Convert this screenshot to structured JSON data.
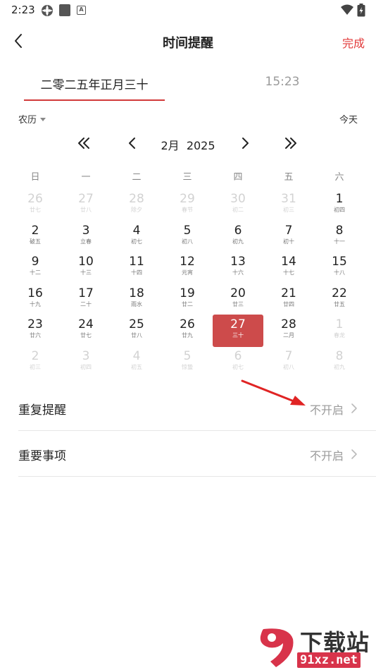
{
  "status_bar": {
    "time": "2:23"
  },
  "header": {
    "title": "时间提醒",
    "done_label": "完成"
  },
  "tabs": {
    "date_label": "二零二五年正月三十",
    "time_label": "15:23"
  },
  "toolbar": {
    "calendar_type": "农历",
    "today_label": "今天"
  },
  "month_nav": {
    "month": "2月",
    "year": "2025"
  },
  "weekdays": [
    "日",
    "一",
    "二",
    "三",
    "四",
    "五",
    "六"
  ],
  "calendar": {
    "selected_day": "27",
    "weeks": [
      [
        {
          "d": "26",
          "l": "廿七",
          "m": true
        },
        {
          "d": "27",
          "l": "廿八",
          "m": true
        },
        {
          "d": "28",
          "l": "除夕",
          "m": true
        },
        {
          "d": "29",
          "l": "春节",
          "m": true
        },
        {
          "d": "30",
          "l": "初二",
          "m": true
        },
        {
          "d": "31",
          "l": "初三",
          "m": true
        },
        {
          "d": "1",
          "l": "初四",
          "m": false
        }
      ],
      [
        {
          "d": "2",
          "l": "破五",
          "m": false
        },
        {
          "d": "3",
          "l": "立春",
          "m": false
        },
        {
          "d": "4",
          "l": "初七",
          "m": false
        },
        {
          "d": "5",
          "l": "初八",
          "m": false
        },
        {
          "d": "6",
          "l": "初九",
          "m": false
        },
        {
          "d": "7",
          "l": "初十",
          "m": false
        },
        {
          "d": "8",
          "l": "十一",
          "m": false
        }
      ],
      [
        {
          "d": "9",
          "l": "十二",
          "m": false
        },
        {
          "d": "10",
          "l": "十三",
          "m": false
        },
        {
          "d": "11",
          "l": "十四",
          "m": false
        },
        {
          "d": "12",
          "l": "元宵",
          "m": false
        },
        {
          "d": "13",
          "l": "十六",
          "m": false
        },
        {
          "d": "14",
          "l": "十七",
          "m": false
        },
        {
          "d": "15",
          "l": "十八",
          "m": false
        }
      ],
      [
        {
          "d": "16",
          "l": "十九",
          "m": false
        },
        {
          "d": "17",
          "l": "二十",
          "m": false
        },
        {
          "d": "18",
          "l": "雨水",
          "m": false
        },
        {
          "d": "19",
          "l": "廿二",
          "m": false
        },
        {
          "d": "20",
          "l": "廿三",
          "m": false
        },
        {
          "d": "21",
          "l": "廿四",
          "m": false
        },
        {
          "d": "22",
          "l": "廿五",
          "m": false
        }
      ],
      [
        {
          "d": "23",
          "l": "廿六",
          "m": false
        },
        {
          "d": "24",
          "l": "廿七",
          "m": false
        },
        {
          "d": "25",
          "l": "廿八",
          "m": false
        },
        {
          "d": "26",
          "l": "廿九",
          "m": false
        },
        {
          "d": "27",
          "l": "三十",
          "m": false,
          "s": true
        },
        {
          "d": "28",
          "l": "二月",
          "m": false
        },
        {
          "d": "1",
          "l": "春龙",
          "m": true
        }
      ],
      [
        {
          "d": "2",
          "l": "初三",
          "m": true
        },
        {
          "d": "3",
          "l": "初四",
          "m": true
        },
        {
          "d": "4",
          "l": "初五",
          "m": true
        },
        {
          "d": "5",
          "l": "惊蛰",
          "m": true
        },
        {
          "d": "6",
          "l": "初七",
          "m": true
        },
        {
          "d": "7",
          "l": "初八",
          "m": true
        },
        {
          "d": "8",
          "l": "初九",
          "m": true
        }
      ]
    ]
  },
  "settings": {
    "repeat": {
      "label": "重复提醒",
      "value": "不开启"
    },
    "important": {
      "label": "重要事项",
      "value": "不开启"
    }
  },
  "watermark": {
    "brand": "下载站",
    "url": "91xz.net"
  },
  "colors": {
    "accent": "#e23b3b",
    "selected_bg": "#cd4b4b",
    "muted_text": "#d2d2d2"
  }
}
